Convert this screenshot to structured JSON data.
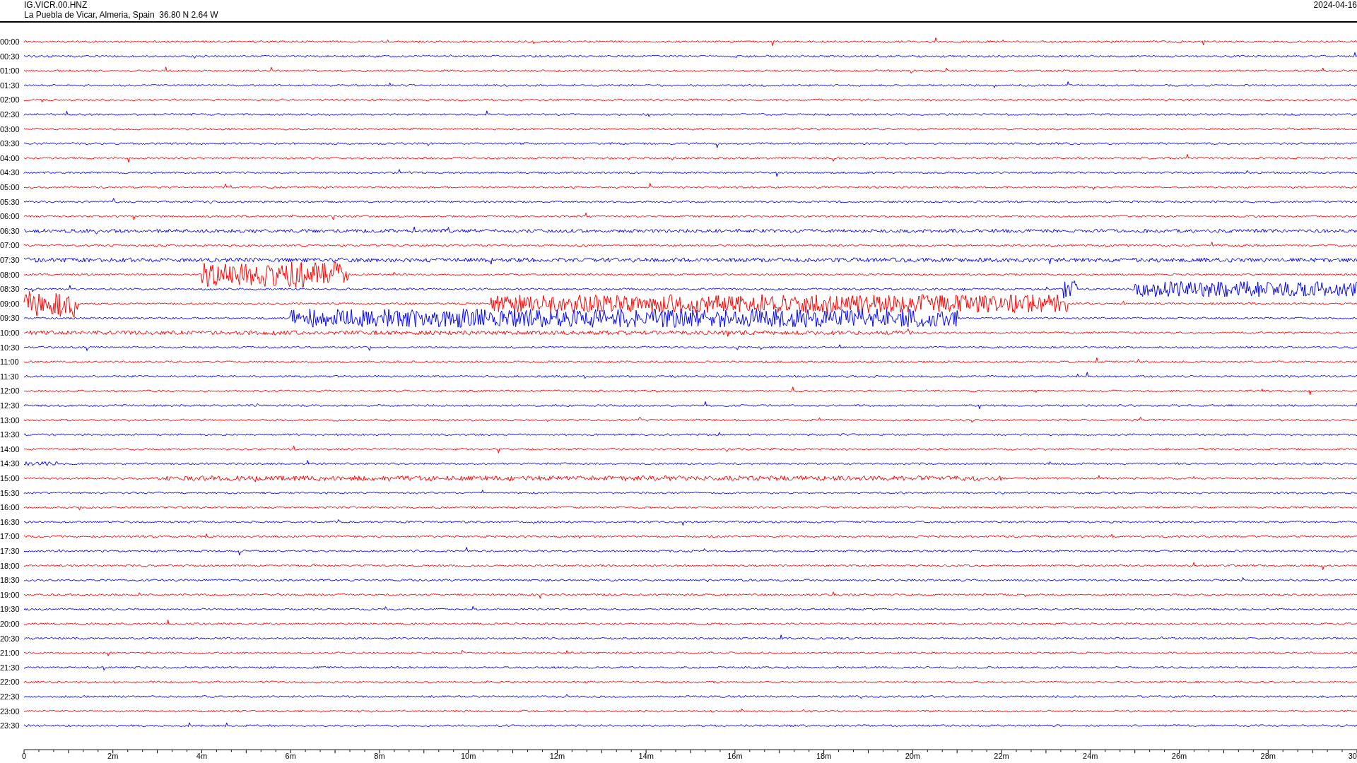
{
  "header": {
    "station": "IG.VICR.00.HNZ",
    "location": "La Puebla de Vicar, Almeria, Spain  36.80 N 2.64 W",
    "date": "2024-04-16"
  },
  "traces": [
    {
      "label": "00:00",
      "color": "#ff0000"
    },
    {
      "label": "00:30",
      "color": "#0000ff"
    },
    {
      "label": "01:00",
      "color": "#ff0000"
    },
    {
      "label": "01:30",
      "color": "#0000ff"
    },
    {
      "label": "02:00",
      "color": "#ff0000"
    },
    {
      "label": "02:30",
      "color": "#0000ff"
    },
    {
      "label": "03:00",
      "color": "#ff0000"
    },
    {
      "label": "03:30",
      "color": "#0000ff"
    },
    {
      "label": "04:00",
      "color": "#ff0000"
    },
    {
      "label": "04:30",
      "color": "#0000ff"
    },
    {
      "label": "05:00",
      "color": "#ff0000"
    },
    {
      "label": "05:30",
      "color": "#0000ff"
    },
    {
      "label": "06:00",
      "color": "#ff0000"
    },
    {
      "label": "06:30",
      "color": "#0000ff"
    },
    {
      "label": "07:00",
      "color": "#ff0000"
    },
    {
      "label": "07:30",
      "color": "#0000ff"
    },
    {
      "label": "08:00",
      "color": "#ff0000"
    },
    {
      "label": "08:30",
      "color": "#0000ff"
    },
    {
      "label": "09:00",
      "color": "#ff0000"
    },
    {
      "label": "09:30",
      "color": "#0000ff"
    },
    {
      "label": "10:00",
      "color": "#ff0000"
    },
    {
      "label": "10:30",
      "color": "#0000ff"
    },
    {
      "label": "11:00",
      "color": "#ff0000"
    },
    {
      "label": "11:30",
      "color": "#0000ff"
    },
    {
      "label": "12:00",
      "color": "#ff0000"
    },
    {
      "label": "12:30",
      "color": "#0000ff"
    },
    {
      "label": "13:00",
      "color": "#ff0000"
    },
    {
      "label": "13:30",
      "color": "#0000ff"
    },
    {
      "label": "14:00",
      "color": "#ff0000"
    },
    {
      "label": "14:30",
      "color": "#0000ff"
    },
    {
      "label": "15:00",
      "color": "#ff0000"
    },
    {
      "label": "15:30",
      "color": "#0000ff"
    },
    {
      "label": "16:00",
      "color": "#ff0000"
    },
    {
      "label": "16:30",
      "color": "#0000ff"
    },
    {
      "label": "17:00",
      "color": "#ff0000"
    },
    {
      "label": "17:30",
      "color": "#0000ff"
    },
    {
      "label": "18:00",
      "color": "#ff0000"
    },
    {
      "label": "18:30",
      "color": "#0000ff"
    },
    {
      "label": "19:00",
      "color": "#ff0000"
    },
    {
      "label": "19:30",
      "color": "#0000ff"
    },
    {
      "label": "20:00",
      "color": "#ff0000"
    },
    {
      "label": "20:30",
      "color": "#0000ff"
    },
    {
      "label": "21:00",
      "color": "#ff0000"
    },
    {
      "label": "21:30",
      "color": "#0000ff"
    },
    {
      "label": "22:00",
      "color": "#ff0000"
    },
    {
      "label": "22:30",
      "color": "#0000ff"
    },
    {
      "label": "23:00",
      "color": "#ff0000"
    },
    {
      "label": "23:30",
      "color": "#0000ff"
    }
  ],
  "x_axis": {
    "labels": [
      "0",
      "2m",
      "4m",
      "6m",
      "8m",
      "10m",
      "12m",
      "14m",
      "16m",
      "18m",
      "20m",
      "22m",
      "24m",
      "26m",
      "28m",
      "30"
    ]
  }
}
